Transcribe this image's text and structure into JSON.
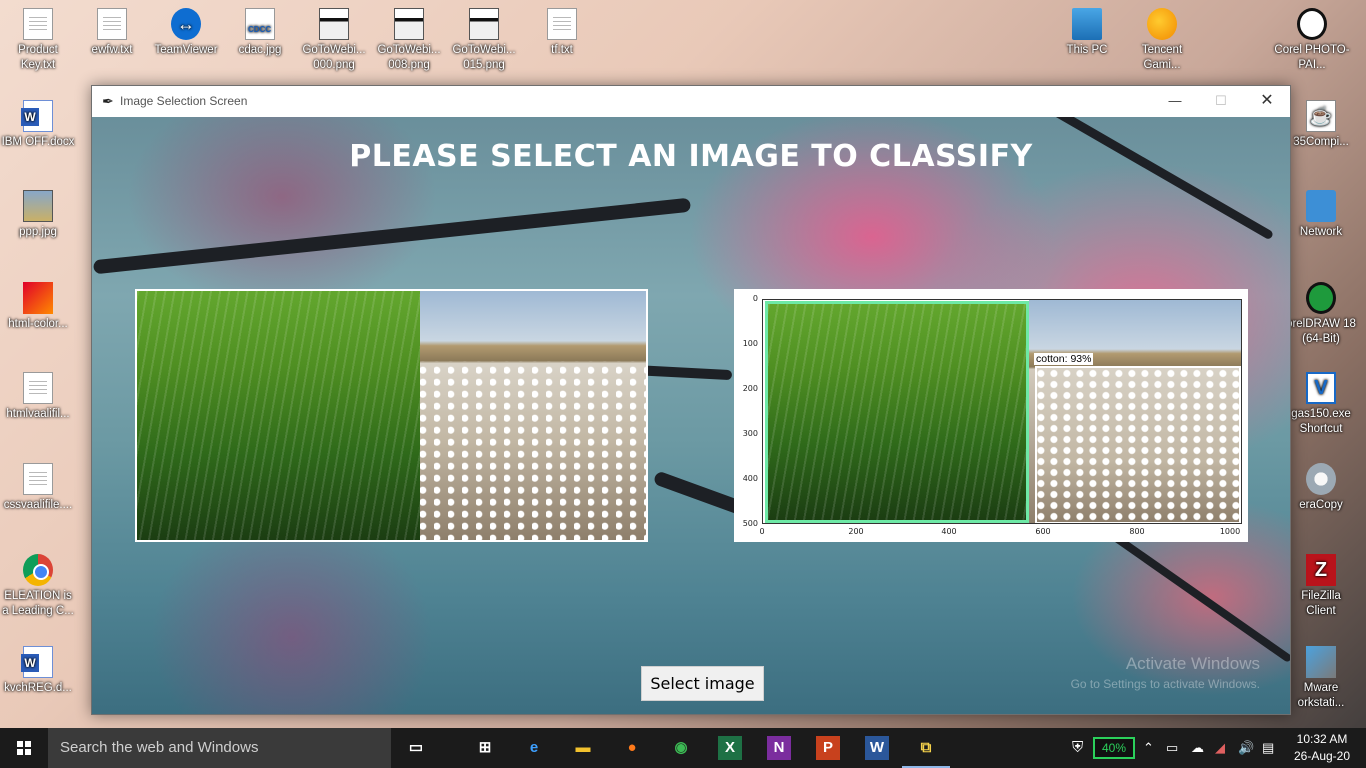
{
  "desktop": {
    "icons_top": [
      {
        "label": "Product Key.txt",
        "icon": "text-file-icon"
      },
      {
        "label": "ewfw.txt",
        "icon": "text-file-icon"
      },
      {
        "label": "TeamViewer",
        "icon": "teamviewer-icon"
      },
      {
        "label": "cdac.jpg",
        "icon": "image-file-icon"
      },
      {
        "label": "GoToWebi... 000.png",
        "icon": "image-file-icon"
      },
      {
        "label": "GoToWebi... 008.png",
        "icon": "image-file-icon"
      },
      {
        "label": "GoToWebi... 015.png",
        "icon": "image-file-icon"
      },
      {
        "label": "tf.txt",
        "icon": "text-file-icon"
      }
    ],
    "icons_left": [
      {
        "label": "IBM OFF.docx",
        "icon": "word-doc-icon"
      },
      {
        "label": "ppp.jpg",
        "icon": "image-file-icon"
      },
      {
        "label": "html-color...",
        "icon": "color-image-icon"
      },
      {
        "label": "htmlvaalifil...",
        "icon": "text-file-icon"
      },
      {
        "label": "cssvaalifile....",
        "icon": "text-file-icon"
      },
      {
        "label": "ELEATION is a Leading C...",
        "icon": "chrome-icon"
      },
      {
        "label": "kvchREG.d...",
        "icon": "word-doc-icon"
      }
    ],
    "icons_right_top": [
      {
        "label": "This PC",
        "icon": "this-pc-icon"
      },
      {
        "label": "Tencent Gami...",
        "icon": "tencent-icon"
      },
      {
        "label": "Corel PHOTO-PAI...",
        "icon": "corel-photo-icon"
      }
    ],
    "icons_right": [
      {
        "label": "35Compi...",
        "icon": "java-icon"
      },
      {
        "label": "Network",
        "icon": "network-icon"
      },
      {
        "label": "orelDRAW 18 (64-Bit)",
        "icon": "coreldraw-icon"
      },
      {
        "label": "gas150.exe Shortcut",
        "icon": "v-app-icon"
      },
      {
        "label": "eraCopy",
        "icon": "teracopy-icon"
      },
      {
        "label": "FileZilla Client",
        "icon": "filezilla-icon"
      },
      {
        "label": "Mware orkstati...",
        "icon": "vmware-icon"
      }
    ]
  },
  "window": {
    "title": "Image Selection Screen",
    "minimize": "—",
    "maximize": "☐",
    "close": "✕",
    "heading": "PLEASE SELECT AN IMAGE TO CLASSIFY",
    "detection_label": "cotton: 93%",
    "y_ticks": [
      "0",
      "100",
      "200",
      "300",
      "400",
      "500"
    ],
    "x_ticks": [
      "0",
      "200",
      "400",
      "600",
      "800",
      "1000"
    ],
    "select_button": "Select image",
    "watermark_line1": "Activate Windows",
    "watermark_line2": "Go to Settings to activate Windows."
  },
  "taskbar": {
    "search_placeholder": "Search the web and Windows",
    "battery": "40%",
    "time": "10:32 AM",
    "date": "26-Aug-20"
  }
}
